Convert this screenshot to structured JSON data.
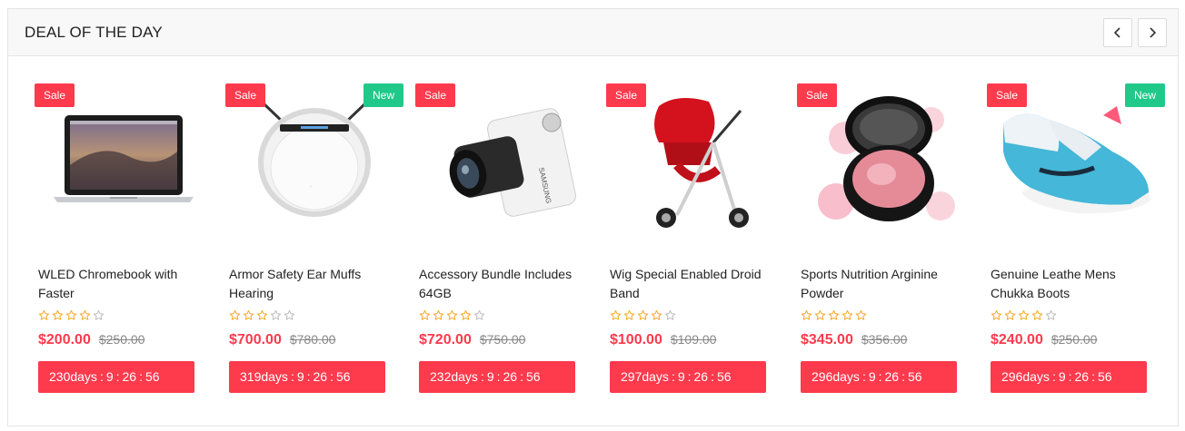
{
  "section": {
    "title": "DEAL OF THE DAY"
  },
  "colors": {
    "accent": "#fe3a4d",
    "new_badge": "#20c98a",
    "star": "#f5a623",
    "star_empty": "#bbbbbb"
  },
  "products": [
    {
      "name": "WLED Chromebook with Faster",
      "sale_badge": "Sale",
      "new_badge": null,
      "rating": 4,
      "price": "$200.00",
      "old_price": "$250.00",
      "countdown": {
        "days": "230days",
        "h": "9",
        "m": "26",
        "s": "56"
      },
      "image": "laptop"
    },
    {
      "name": "Armor Safety Ear Muffs Hearing",
      "sale_badge": "Sale",
      "new_badge": "New",
      "rating": 3,
      "price": "$700.00",
      "old_price": "$780.00",
      "countdown": {
        "days": "319days",
        "h": "9",
        "m": "26",
        "s": "56"
      },
      "image": "robot-vacuum"
    },
    {
      "name": "Accessory Bundle Includes 64GB",
      "sale_badge": "Sale",
      "new_badge": null,
      "rating": 4,
      "price": "$720.00",
      "old_price": "$750.00",
      "countdown": {
        "days": "232days",
        "h": "9",
        "m": "26",
        "s": "56"
      },
      "image": "camera"
    },
    {
      "name": "Wig Special Enabled Droid Band",
      "sale_badge": "Sale",
      "new_badge": null,
      "rating": 4,
      "price": "$100.00",
      "old_price": "$109.00",
      "countdown": {
        "days": "297days",
        "h": "9",
        "m": "26",
        "s": "56"
      },
      "image": "stroller"
    },
    {
      "name": "Sports Nutrition Arginine Powder",
      "sale_badge": "Sale",
      "new_badge": null,
      "rating": 5,
      "price": "$345.00",
      "old_price": "$356.00",
      "countdown": {
        "days": "296days",
        "h": "9",
        "m": "26",
        "s": "56"
      },
      "image": "cosmetic-compact"
    },
    {
      "name": "Genuine Leathe Mens Chukka Boots",
      "sale_badge": "Sale",
      "new_badge": "New",
      "rating": 4,
      "price": "$240.00",
      "old_price": "$250.00",
      "countdown": {
        "days": "296days",
        "h": "9",
        "m": "26",
        "s": "56"
      },
      "image": "sneaker"
    }
  ]
}
